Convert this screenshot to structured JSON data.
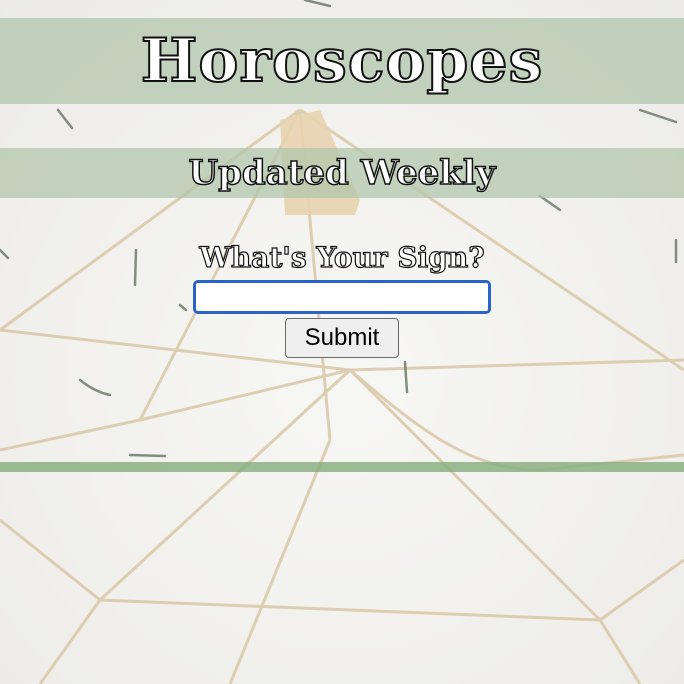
{
  "header": {
    "title": "Horoscopes",
    "subtitle": "Updated Weekly"
  },
  "form": {
    "label": "What's Your Sign?",
    "input_value": "",
    "input_placeholder": "",
    "submit_label": "Submit"
  },
  "colors": {
    "band": "#b0c5ab",
    "divider": "#8caf82",
    "input_border": "#2a64c5",
    "background": "#f3f2ef"
  }
}
